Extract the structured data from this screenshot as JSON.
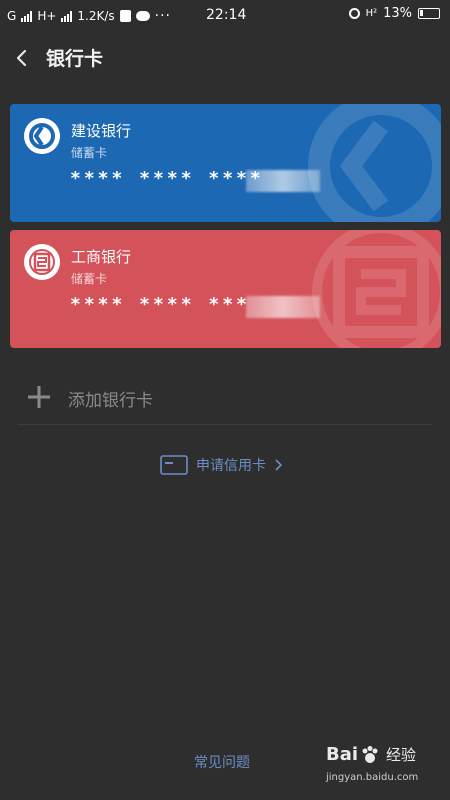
{
  "status_bar": {
    "carrier_g": "G",
    "carrier_h": "H+",
    "speed": "1.2K/s",
    "dots": "···",
    "time": "22:14",
    "hd": "H²",
    "battery": "13%"
  },
  "header": {
    "title": "银行卡"
  },
  "cards": [
    {
      "bank": "建设银行",
      "type": "储蓄卡",
      "number_masked": "**** **** ****",
      "color": "#1d68b3"
    },
    {
      "bank": "工商银行",
      "type": "储蓄卡",
      "number_masked": "**** **** ***",
      "color": "#d4535a"
    }
  ],
  "add_card": {
    "label": "添加银行卡"
  },
  "apply_credit": {
    "label": "申请信用卡"
  },
  "faq": {
    "label": "常见问题"
  },
  "watermark": {
    "brand": "Bai",
    "brand_suffix": "经验",
    "url": "jingyan.baidu.com"
  },
  "colors": {
    "background": "#2e2e2e",
    "ccb_card": "#1d68b3",
    "icbc_card": "#d4535a",
    "link": "#6b8ec7"
  }
}
